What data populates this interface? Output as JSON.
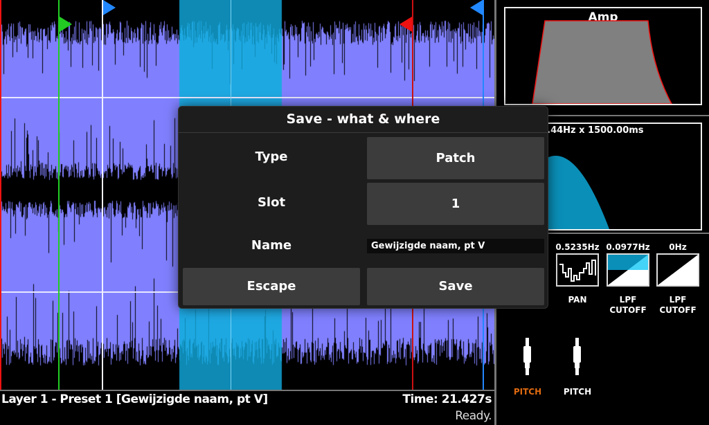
{
  "waveform": {
    "colors": {
      "background": "#8080ff",
      "selection": "#1ea8e2",
      "wave": "#000000",
      "selection_wave": "#0e8ab4"
    },
    "markers": [
      {
        "name": "loop-start-marker",
        "color": "#22cc22"
      },
      {
        "name": "play-start-marker",
        "color": "#2288ff"
      },
      {
        "name": "loop-end-marker",
        "color": "#ee1111"
      },
      {
        "name": "play-end-marker",
        "color": "#2288ff"
      }
    ]
  },
  "status": {
    "layer_info": "Layer 1 - Preset 1 [Gewijzigde naam, pt V]",
    "time": "Time: 21.427s",
    "state": "Ready."
  },
  "envelope": {
    "title": "Amp",
    "fill": "#808080",
    "stroke": "#ee1111"
  },
  "lfo": {
    "label": "2 = 213.44Hz x 1500.00ms",
    "fill": "#0a8fb8"
  },
  "modulators": [
    {
      "value": "0.5235Hz",
      "label": "PAN",
      "icon": "random-step-wave-icon"
    },
    {
      "value": "0.0977Hz",
      "label": "LPF CUTOFF",
      "icon": "ramp-wave-icon"
    },
    {
      "value": "0Hz",
      "label": "LPF CUTOFF",
      "icon": "ramp-wave-icon"
    }
  ],
  "jacks": [
    {
      "label": "PITCH",
      "color": "#e06a10"
    },
    {
      "label": "PITCH",
      "color": "#ffffff"
    }
  ],
  "dialog": {
    "title": "Save - what & where",
    "type_label": "Type",
    "type_value": "Patch",
    "slot_label": "Slot",
    "slot_value": "1",
    "name_label": "Name",
    "name_value": "Gewijzigde naam, pt V",
    "escape_label": "Escape",
    "save_label": "Save"
  }
}
